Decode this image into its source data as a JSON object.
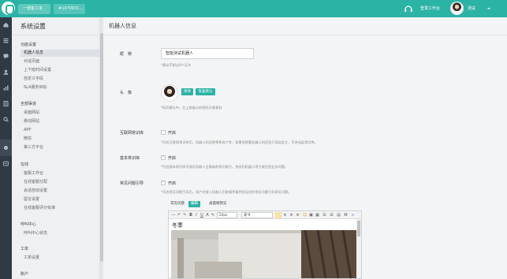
{
  "topbar": {
    "tabs": [
      {
        "label": "一號客工单"
      },
      {
        "label": "#1470931..."
      }
    ],
    "workspace_label": "登录工作台",
    "user_label": "测试"
  },
  "sidebar": {
    "title": "系统设置",
    "groups": [
      {
        "title": "功能设置",
        "items": [
          "机器人信息",
          "对话页面",
          "上下班时间设置",
          "自定义字段",
          "SLA服务目标"
        ]
      },
      {
        "title": "全部渠道",
        "items": [
          "桌面网站",
          "移动网站",
          "APP",
          "微信",
          "第三方平台"
        ]
      },
      {
        "title": "在线",
        "items": [
          "客服工作台",
          "在线客服分配",
          "会话自动设置",
          "留言设置",
          "在线客服评分标准"
        ]
      },
      {
        "title": "呼叫中心",
        "items": [
          "呼叫中心状态"
        ]
      },
      {
        "title": "工单",
        "items": [
          "工单设置"
        ]
      },
      {
        "title": "账户",
        "items": []
      }
    ]
  },
  "main": {
    "title": "机器人信息",
    "name_label": "昵　称",
    "name_value": "智能测试机器人",
    "name_hint": "*建议不超过8个汉字",
    "avatar_label": "头　像",
    "avatar_edit": "修改",
    "avatar_default": "恢复默认",
    "avatar_hint": "*网页聊天中，左上角展示的图形头像素材",
    "internet_label": "互联网常识库",
    "internet_check": "开启",
    "internet_checked": false,
    "internet_hint": "*开启互联网常识库后，机器人的回答将更具个性；如果您想要机器人的回答只用自定义，可关闭此常识库。",
    "basic_label": "基本常识库",
    "basic_check": "开启",
    "basic_checked": true,
    "basic_hint": "*开启基本常识库可保证机器人会基础的常识能力，关闭后机器人将只能回答业务问题。",
    "faq_label": "常见问题引导",
    "faq_check": "开启",
    "faq_checked": true,
    "faq_hint": "*开启常见问题引导后，用户在接入机器人后能顺序看到您设定的常见问题引导常见问题。",
    "sub_tabs": [
      "常见问题",
      "编辑",
      "桌面端预览"
    ],
    "editor": {
      "font_size": "24px",
      "font_family": "隶书",
      "content": "冬季"
    }
  },
  "colors": {
    "accent": "#2bb3a6",
    "rail": "#2f3a45",
    "sidebar": "#eef0f2"
  }
}
